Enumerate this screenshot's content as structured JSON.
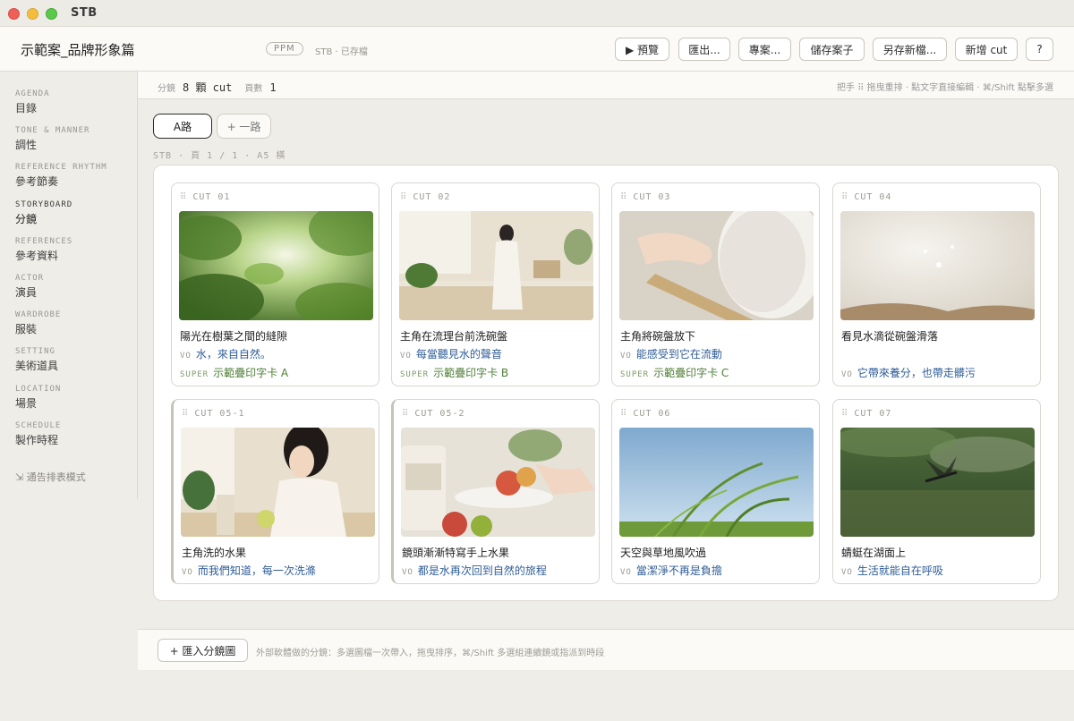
{
  "app": {
    "title": "STB"
  },
  "header": {
    "doc_title": "示範案_品牌形象篇",
    "badge": "PPM",
    "status": "STB · 已存檔",
    "buttons": {
      "preview": "▶ 預覽",
      "export": "匯出...",
      "project": "專案...",
      "save_case": "儲存案子",
      "save_new": "另存新檔...",
      "add_cut": "新增 cut",
      "help": "?"
    }
  },
  "sidebar": {
    "items": [
      {
        "en": "AGENDA",
        "zh": "目錄"
      },
      {
        "en": "TONE & MANNER",
        "zh": "調性"
      },
      {
        "en": "REFERENCE RHYTHM",
        "zh": "參考節奏"
      },
      {
        "en": "STORYBOARD",
        "zh": "分鏡"
      },
      {
        "en": "REFERENCES",
        "zh": "參考資料"
      },
      {
        "en": "ACTOR",
        "zh": "演員"
      },
      {
        "en": "WARDROBE",
        "zh": "服裝"
      },
      {
        "en": "SETTING",
        "zh": "美術道具"
      },
      {
        "en": "LOCATION",
        "zh": "場景"
      },
      {
        "en": "SCHEDULE",
        "zh": "製作時程"
      }
    ],
    "active_index": 3,
    "footer_link": "⇲ 通告排表模式"
  },
  "infobar": {
    "cuts_label": "分鏡",
    "cuts_value": "8 顆 cut",
    "pages_label": "頁數",
    "pages_value": "1",
    "hint": "把手 ⠿ 拖曳重排 · 點文字直接編輯 · ⌘/Shift 點擊多選"
  },
  "tabs": {
    "active": "A路",
    "add": "+ 一路"
  },
  "page_meta": "STB · 頁 1 / 1 · A5 橫",
  "cuts": [
    {
      "id": "CUT 01",
      "desc": "陽光在樹葉之間的縫隙",
      "vo": "水，來自自然。",
      "super": "示範疊印字卡 A",
      "scene": "leaves"
    },
    {
      "id": "CUT 02",
      "desc": "主角在流理台前洗碗盤",
      "vo": "每當聽見水的聲音",
      "super": "示範疊印字卡 B",
      "scene": "kitchen"
    },
    {
      "id": "CUT 03",
      "desc": "主角將碗盤放下",
      "vo": "能感受到它在流動",
      "super": "示範疊印字卡 C",
      "scene": "plates"
    },
    {
      "id": "CUT 04",
      "desc": "看見水滴從碗盤滑落",
      "vo": "它帶來養分，也帶走髒污",
      "super": "",
      "scene": "drops"
    },
    {
      "id": "CUT 05-1",
      "desc": "主角洗的水果",
      "vo": "而我們知道，每一次洗滌",
      "super": "",
      "scene": "woman"
    },
    {
      "id": "CUT 05-2",
      "desc": "鏡頭漸漸特寫手上水果",
      "vo": "都是水再次回到自然的旅程",
      "super": "",
      "scene": "fruit"
    },
    {
      "id": "CUT 06",
      "desc": "天空與草地風吹過",
      "vo": "當潔淨不再是負擔",
      "super": "",
      "scene": "sky"
    },
    {
      "id": "CUT 07",
      "desc": "蜻蜓在湖面上",
      "vo": "生活就能自在呼吸",
      "super": "",
      "scene": "lake"
    }
  ],
  "labels": {
    "vo": "VO",
    "super": "SUPER"
  },
  "footer": {
    "import_button": "+ 匯入分鏡圖",
    "hint": "外部軟體做的分鏡：多選圖檔一次帶入，拖曳排序，⌘/Shift 多選組連續鏡或指派到時段"
  }
}
